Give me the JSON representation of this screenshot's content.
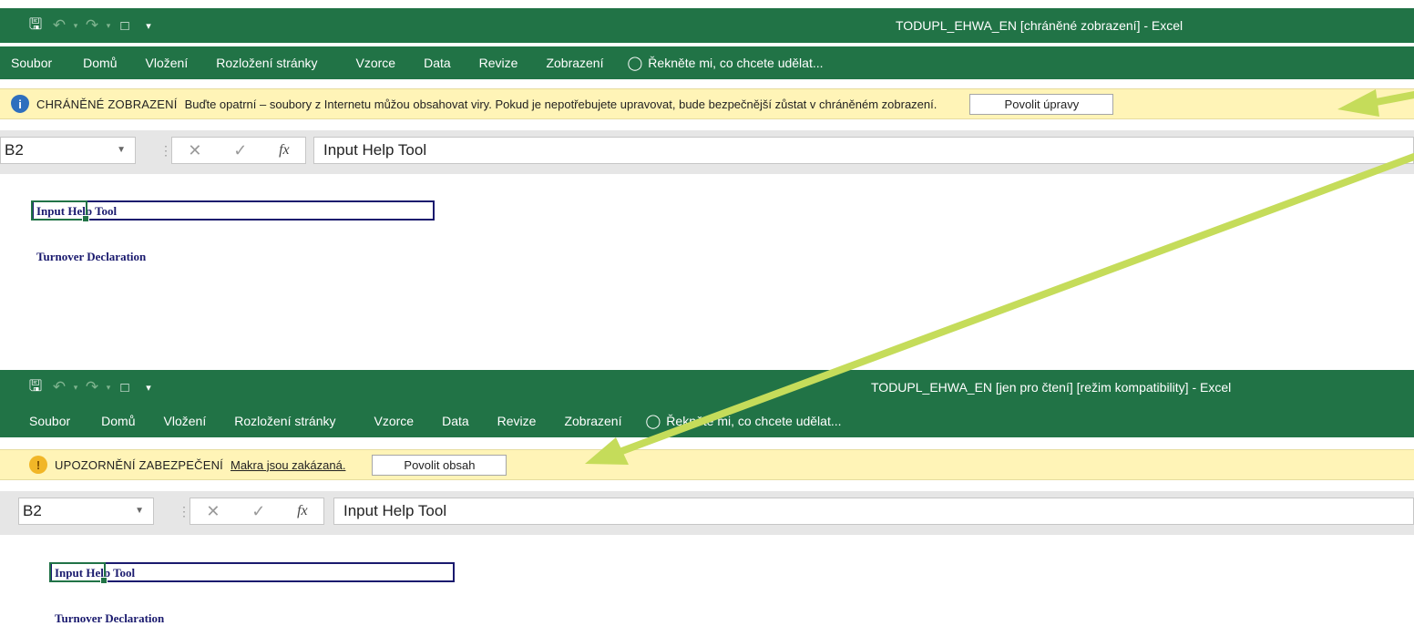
{
  "colors": {
    "excel_green": "#217346",
    "message_bar": "#fff4b7",
    "arrow": "#c5dc5a",
    "sheet_navy": "#1a1a6e"
  },
  "screens": [
    {
      "quick_access": [
        "save-icon",
        "undo-icon",
        "redo-icon",
        "new-document-icon",
        "customize-qat-icon"
      ],
      "window_title": "TODUPL_EHWA_EN  [chráněné zobrazení] - Excel",
      "ribbon_tabs": [
        "Soubor",
        "Domů",
        "Vložení",
        "Rozložení stránky",
        "Vzorce",
        "Data",
        "Revize",
        "Zobrazení"
      ],
      "tell_me": "Řekněte mi, co chcete udělat...",
      "message_bar": {
        "icon": "shield-info-icon",
        "title": "CHRÁNĚNÉ ZOBRAZENÍ",
        "text": "Buďte opatrní – soubory z Internetu můžou obsahovat viry. Pokud je nepotřebujete upravovat, bude bezpečnější zůstat v chráněném zobrazení.",
        "button": "Povolit úpravy"
      },
      "name_box": "B2",
      "formula_content": "Input Help Tool",
      "sheet": {
        "title": "Input Help Tool",
        "subtitle": "Turnover Declaration"
      }
    },
    {
      "quick_access": [
        "save-icon",
        "undo-icon",
        "redo-icon",
        "new-document-icon",
        "customize-qat-icon"
      ],
      "window_title": "TODUPL_EHWA_EN  [jen pro čtení]  [režim kompatibility] - Excel",
      "ribbon_tabs": [
        "Soubor",
        "Domů",
        "Vložení",
        "Rozložení stránky",
        "Vzorce",
        "Data",
        "Revize",
        "Zobrazení"
      ],
      "tell_me": "Řekněte mi, co chcete udělat...",
      "message_bar": {
        "icon": "warning-icon",
        "title": "UPOZORNĚNÍ ZABEZPEČENÍ",
        "link": "Makra jsou zakázaná.",
        "button": "Povolit obsah"
      },
      "name_box": "B2",
      "formula_content": "Input Help Tool",
      "sheet": {
        "title": "Input Help Tool",
        "subtitle": "Turnover Declaration"
      }
    }
  ]
}
